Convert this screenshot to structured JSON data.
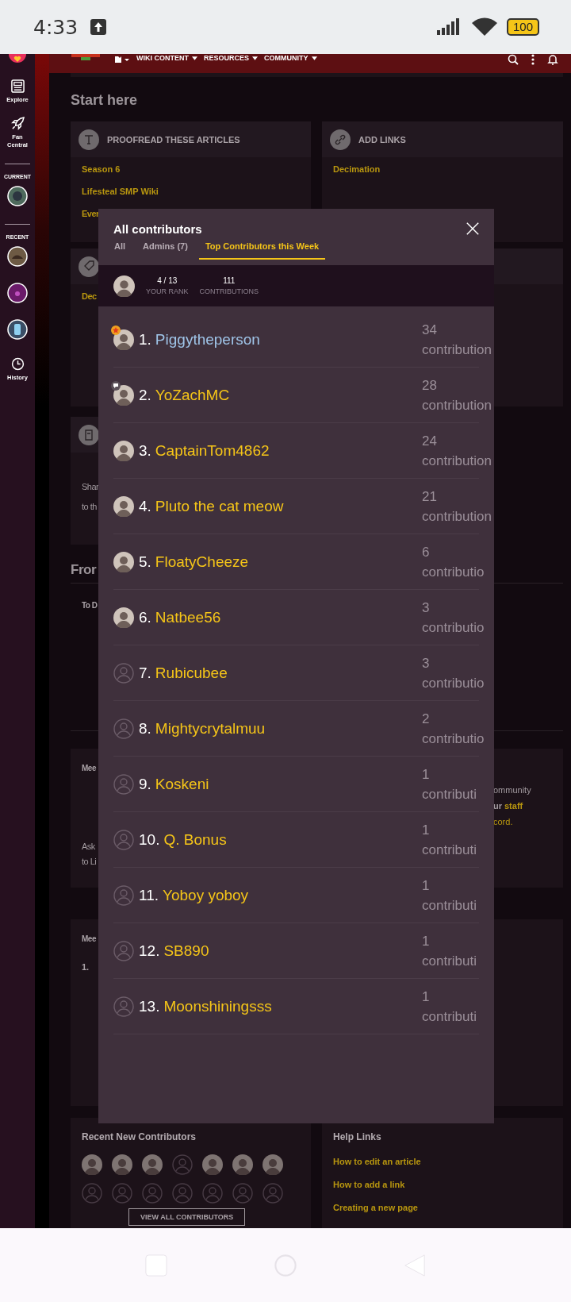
{
  "status_bar": {
    "time": "4:33",
    "battery": "100"
  },
  "top_nav": {
    "items": [
      {
        "label": "WIKI CONTENT"
      },
      {
        "label": "RESOURCES"
      },
      {
        "label": "COMMUNITY"
      }
    ]
  },
  "rail": {
    "items": [
      {
        "label": "Explore",
        "kind": "explore"
      },
      {
        "label": "Fan Central",
        "kind": "rocket"
      }
    ],
    "current_heading": "CURRENT",
    "recent_heading": "RECENT",
    "history": "History"
  },
  "page": {
    "heading": "Start here",
    "proofread": {
      "title": "PROOFREAD THESE ARTICLES",
      "links": [
        "Season 6",
        "Lifesteal SMP Wiki",
        "Ever"
      ]
    },
    "add_links": {
      "title": "ADD LINKS",
      "links": [
        "Decimation"
      ]
    },
    "tag_card": {
      "links": [
        "Dec"
      ]
    },
    "doc_card": {
      "lines": [
        "Shar",
        "to th"
      ]
    },
    "section": {
      "heading": "Fror",
      "subheading": "To D"
    },
    "meet_card": {
      "title": "Mee",
      "lines": [
        "Ask",
        "to Li"
      ]
    },
    "community_card": {
      "text_1": "ommunity",
      "text_2": "ur",
      "link_1": "staff",
      "link_2": "cord."
    },
    "meet_card_2": {
      "title": "Mee",
      "rank": "1."
    },
    "recent_contributors": {
      "title": "Recent New Contributors",
      "avatars": [
        {
          "kind": "photo"
        },
        {
          "kind": "photo"
        },
        {
          "kind": "photo"
        },
        {
          "kind": "default"
        },
        {
          "kind": "photo"
        },
        {
          "kind": "photo"
        },
        {
          "kind": "photo"
        },
        {
          "kind": "default"
        },
        {
          "kind": "default"
        },
        {
          "kind": "default"
        },
        {
          "kind": "default"
        },
        {
          "kind": "default"
        },
        {
          "kind": "default"
        },
        {
          "kind": "default"
        }
      ],
      "button": "VIEW ALL CONTRIBUTORS"
    },
    "help_links": {
      "title": "Help Links",
      "links": [
        "How to edit an article",
        "How to add a link",
        "Creating a new page"
      ]
    }
  },
  "modal": {
    "title": "All contributors",
    "tabs": [
      {
        "label": "All",
        "selected": false
      },
      {
        "label": "Admins (7)",
        "selected": false
      },
      {
        "label": "Top Contributors this Week",
        "selected": true
      }
    ],
    "your_rank": {
      "rank": "4 / 13",
      "rank_label": "YOUR RANK",
      "contributions": "111",
      "contributions_label": "CONTRIBUTIONS"
    },
    "contributors": [
      {
        "rank": "1.",
        "name": "Piggytheperson",
        "color": "#9fc4e8",
        "kind": "starred",
        "count": "34",
        "count_label": "contribution"
      },
      {
        "rank": "2.",
        "name": "YoZachMC",
        "color": "#f5c518",
        "kind": "chat",
        "count": "28",
        "count_label": "contribution"
      },
      {
        "rank": "3.",
        "name": "CaptainTom4862",
        "color": "#f5c518",
        "kind": "photo",
        "count": "24",
        "count_label": "contribution"
      },
      {
        "rank": "4.",
        "name": "Pluto the cat meow",
        "color": "#f5c518",
        "kind": "photo",
        "count": "21",
        "count_label": "contribution"
      },
      {
        "rank": "5.",
        "name": "FloatyCheeze",
        "color": "#f5c518",
        "kind": "photo",
        "count": "6",
        "count_label": "contributio"
      },
      {
        "rank": "6.",
        "name": "Natbee56",
        "color": "#f5c518",
        "kind": "photo",
        "count": "3",
        "count_label": "contributio"
      },
      {
        "rank": "7.",
        "name": "Rubicubee",
        "color": "#f5c518",
        "kind": "default",
        "count": "3",
        "count_label": "contributio"
      },
      {
        "rank": "8.",
        "name": "Mightycrytalmuu",
        "color": "#f5c518",
        "kind": "default",
        "count": "2",
        "count_label": "contributio"
      },
      {
        "rank": "9.",
        "name": "Koskeni",
        "color": "#f5c518",
        "kind": "default",
        "count": "1",
        "count_label": "contributi"
      },
      {
        "rank": "10.",
        "name": "Q. Bonus",
        "color": "#f5c518",
        "kind": "default",
        "count": "1",
        "count_label": "contributi"
      },
      {
        "rank": "11.",
        "name": "Yoboy yoboy",
        "color": "#f5c518",
        "kind": "default",
        "count": "1",
        "count_label": "contributi"
      },
      {
        "rank": "12.",
        "name": "SB890",
        "color": "#f5c518",
        "kind": "default",
        "count": "1",
        "count_label": "contributi"
      },
      {
        "rank": "13.",
        "name": "Moonshiningsss",
        "color": "#f5c518",
        "kind": "default",
        "count": "1",
        "count_label": "contributi"
      }
    ]
  }
}
